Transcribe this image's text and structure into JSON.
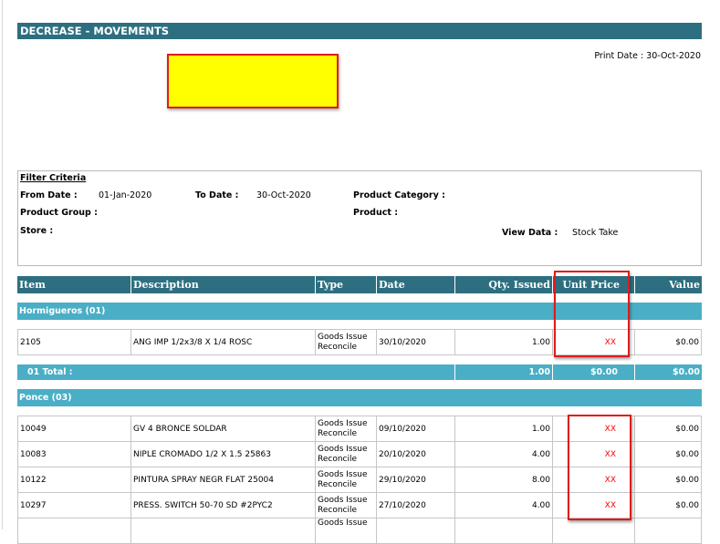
{
  "report": {
    "title": "DECREASE - MOVEMENTS",
    "print_date": "Print Date : 30-Oct-2020"
  },
  "filter": {
    "title": "Filter Criteria",
    "from_date_label": "From Date :",
    "from_date_value": "01-Jan-2020",
    "to_date_label": "To Date :",
    "to_date_value": "30-Oct-2020",
    "product_category_label": "Product Category :",
    "product_group_label": "Product Group :",
    "product_label": "Product :",
    "store_label": "Store :",
    "view_data_label": "View Data :",
    "view_data_value": "Stock Take"
  },
  "table": {
    "headers": {
      "item": "Item",
      "description": "Description",
      "type": "Type",
      "date": "Date",
      "qty": "Qty. Issued",
      "unit_price": "Unit Price",
      "value": "Value"
    },
    "groups": [
      {
        "name": "Hormigueros (01)",
        "rows": [
          {
            "item": "2105",
            "description": "ANG IMP 1/2x3/8 X 1/4 ROSC",
            "type_line1": "Goods Issue",
            "type_line2": "Reconcile",
            "date": "30/10/2020",
            "qty": "1.00",
            "unit_price": "XX",
            "value": "$0.00"
          }
        ],
        "total": {
          "label": "01 Total :",
          "qty": "1.00",
          "unit_price": "$0.00",
          "value": "$0.00"
        }
      },
      {
        "name": "Ponce (03)",
        "rows": [
          {
            "item": "10049",
            "description": "GV 4 BRONCE SOLDAR",
            "type_line1": "Goods Issue",
            "type_line2": "Reconcile",
            "date": "09/10/2020",
            "qty": "1.00",
            "unit_price": "XX",
            "value": "$0.00"
          },
          {
            "item": "10083",
            "description": "NIPLE CROMADO 1/2 X 1.5 25863",
            "type_line1": "Goods Issue",
            "type_line2": "Reconcile",
            "date": "20/10/2020",
            "qty": "4.00",
            "unit_price": "XX",
            "value": "$0.00"
          },
          {
            "item": "10122",
            "description": "PINTURA SPRAY NEGR FLAT 25004",
            "type_line1": "Goods Issue",
            "type_line2": "Reconcile",
            "date": "29/10/2020",
            "qty": "8.00",
            "unit_price": "XX",
            "value": "$0.00"
          },
          {
            "item": "10297",
            "description": "PRESS. SWITCH 50-70  SD #2PYC2",
            "type_line1": "Goods Issue",
            "type_line2": "Reconcile",
            "date": "27/10/2020",
            "qty": "4.00",
            "unit_price": "XX",
            "value": "$0.00"
          },
          {
            "item": "",
            "description": "",
            "type_line1": "Goods Issue",
            "type_line2": "",
            "date": "",
            "qty": "",
            "unit_price": "",
            "value": ""
          }
        ]
      }
    ]
  },
  "colors": {
    "header_bg": "#2d6f80",
    "group_bg": "#4aaec6",
    "redaction_fill": "#ffff00",
    "highlight_border": "#e01b1b",
    "masked_price_text": "#ff0000"
  }
}
